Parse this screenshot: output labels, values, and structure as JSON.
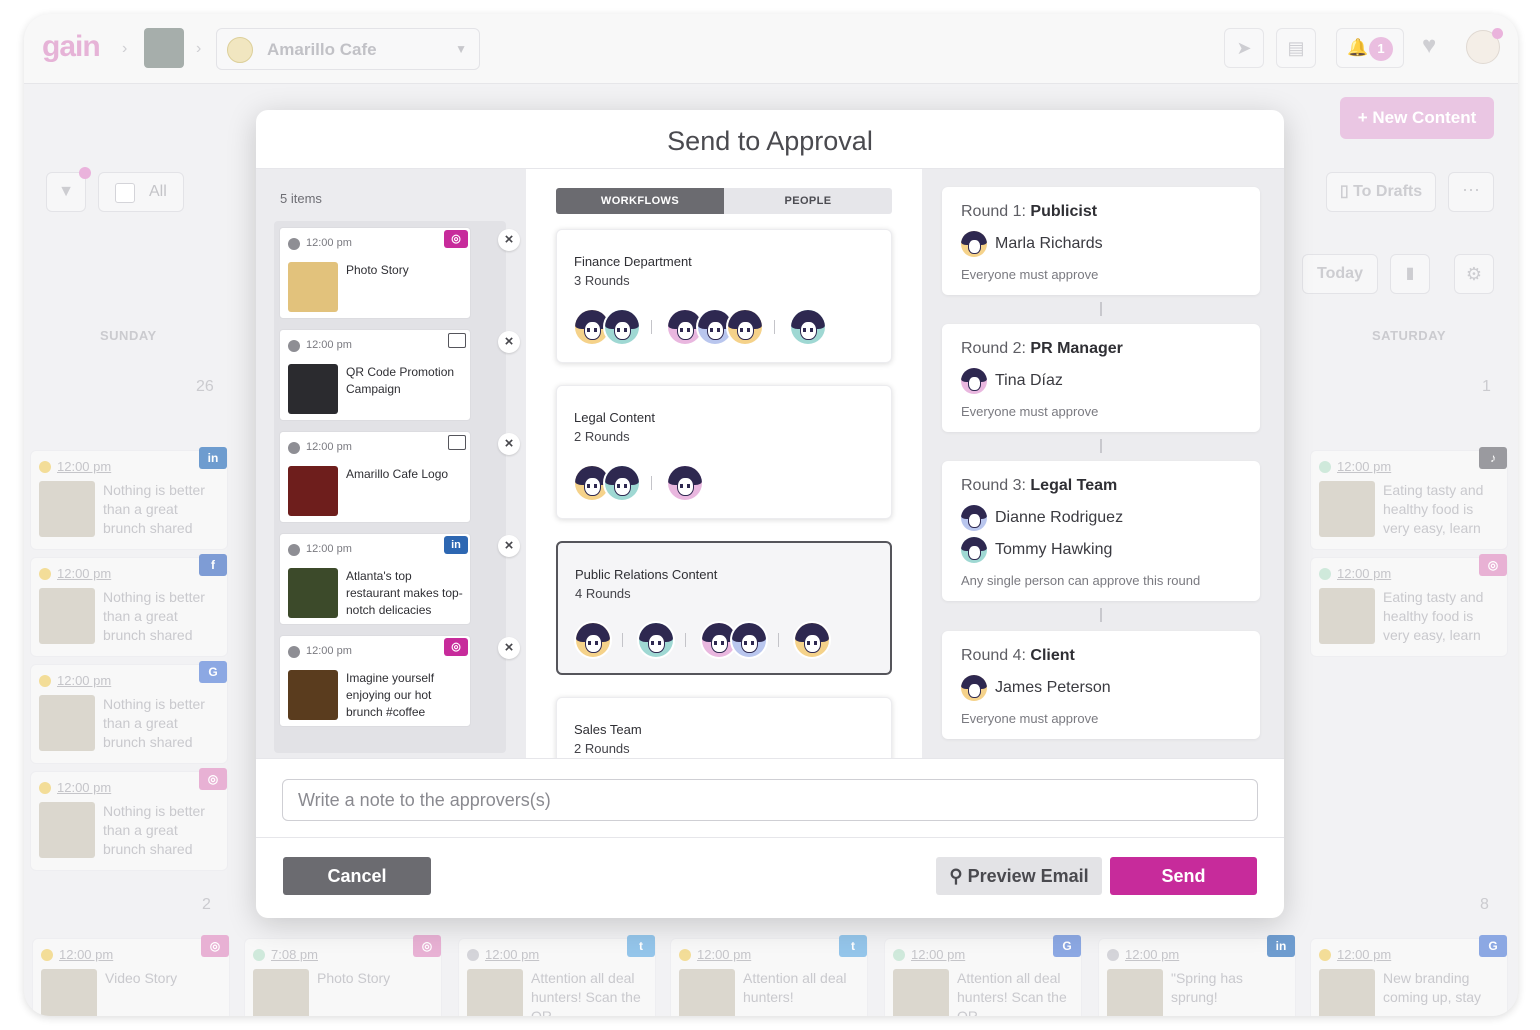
{
  "app": {
    "logo": "gain",
    "location": "Amarillo Cafe",
    "notification_count": "1",
    "new_content_label": "New Content",
    "filter_all_label": "All",
    "to_drafts_label": "To Drafts",
    "today_label": "Today",
    "day_headers": [
      "SUNDAY",
      "SATURDAY"
    ],
    "dates": [
      "26",
      "1",
      "2",
      "8"
    ]
  },
  "calendar": {
    "sunday": [
      {
        "time": "12:00 pm",
        "network": "in",
        "network_color": "#5b8fc9",
        "text": "Nothing is better than a great brunch shared"
      },
      {
        "time": "12:00 pm",
        "network": "f",
        "network_color": "#6d8fd0",
        "text": "Nothing is better than a great brunch shared"
      },
      {
        "time": "12:00 pm",
        "network": "G",
        "network_color": "#7d9de0",
        "text": "Nothing is better than a great brunch shared"
      },
      {
        "time": "12:00 pm",
        "network": "◎",
        "network_color": "#e5a7cf",
        "text": "Nothing is better than a great brunch shared"
      }
    ],
    "saturday": [
      {
        "time": "12:00 pm",
        "network": "♪",
        "network_color": "#8d8d92",
        "text": "Eating tasty and healthy food is very easy, learn"
      },
      {
        "time": "12:00 pm",
        "network": "◎",
        "network_color": "#e5a7cf",
        "text": "Eating tasty and healthy food is very easy, learn"
      }
    ],
    "bottom_row": [
      {
        "time": "12:00 pm",
        "network": "◎",
        "network_color": "#e5a7cf",
        "text": "Video Story"
      },
      {
        "time": "7:08 pm",
        "network": "◎",
        "network_color": "#e5a7cf",
        "text": "Photo Story"
      },
      {
        "time": "12:00 pm",
        "network": "t",
        "network_color": "#86bde8",
        "text": "Attention all deal hunters! Scan the QR"
      },
      {
        "time": "12:00 pm",
        "network": "t",
        "network_color": "#86bde8",
        "text": "Attention all deal hunters!"
      },
      {
        "time": "12:00 pm",
        "network": "G",
        "network_color": "#7d9de0",
        "text": "Attention all deal hunters! Scan the QR"
      },
      {
        "time": "12:00 pm",
        "network": "in",
        "network_color": "#5b8fc9",
        "text": "\"Spring has sprung!"
      },
      {
        "time": "12:00 pm",
        "network": "G",
        "network_color": "#7d9de0",
        "text": "New branding coming up, stay"
      }
    ]
  },
  "modal": {
    "title": "Send to Approval",
    "items_count": "5 items",
    "items": [
      {
        "time": "12:00 pm",
        "title": "Photo Story",
        "network": "◎",
        "network_color": "#c72b9b",
        "thumb_color": "#e2c27c"
      },
      {
        "time": "12:00 pm",
        "title": "QR Code Promotion Campaign",
        "network": "book",
        "network_color": "",
        "thumb_color": "#2b2b2f"
      },
      {
        "time": "12:00 pm",
        "title": "Amarillo Cafe Logo",
        "network": "image",
        "network_color": "",
        "thumb_color": "#6e1e1c"
      },
      {
        "time": "12:00 pm",
        "title": "Atlanta's top restaurant makes top-notch delicacies",
        "network": "in",
        "network_color": "#2d67b2",
        "thumb_color": "#3c4a2a"
      },
      {
        "time": "12:00 pm",
        "title": "Imagine yourself enjoying our hot brunch #coffee",
        "network": "◎",
        "network_color": "#c72b9b",
        "thumb_color": "#5a3c1e"
      }
    ],
    "tabs": {
      "workflows": "WORKFLOWS",
      "people": "PEOPLE"
    },
    "workflows": [
      {
        "name": "Finance Department",
        "rounds": "3 Rounds"
      },
      {
        "name": "Legal Content",
        "rounds": "2 Rounds"
      },
      {
        "name": "Public Relations Content",
        "rounds": "4 Rounds"
      },
      {
        "name": "Sales Team",
        "rounds": "2 Rounds"
      }
    ],
    "rounds": [
      {
        "prefix": "Round 1:",
        "role": "Publicist",
        "people": [
          "Marla Richards"
        ],
        "note": "Everyone must approve"
      },
      {
        "prefix": "Round 2:",
        "role": "PR Manager",
        "people": [
          "Tina Díaz"
        ],
        "note": "Everyone must approve"
      },
      {
        "prefix": "Round 3:",
        "role": "Legal Team",
        "people": [
          "Dianne Rodriguez",
          "Tommy Hawking"
        ],
        "note": "Any single person can approve this round"
      },
      {
        "prefix": "Round 4:",
        "role": "Client",
        "people": [
          "James Peterson"
        ],
        "note": "Everyone must approve"
      }
    ],
    "note_placeholder": "Write a note to the approvers(s)",
    "cancel_label": "Cancel",
    "preview_label": "Preview Email",
    "send_label": "Send",
    "colors": {
      "accent": "#c72b9b",
      "neutral_button": "#6b6b70"
    }
  }
}
